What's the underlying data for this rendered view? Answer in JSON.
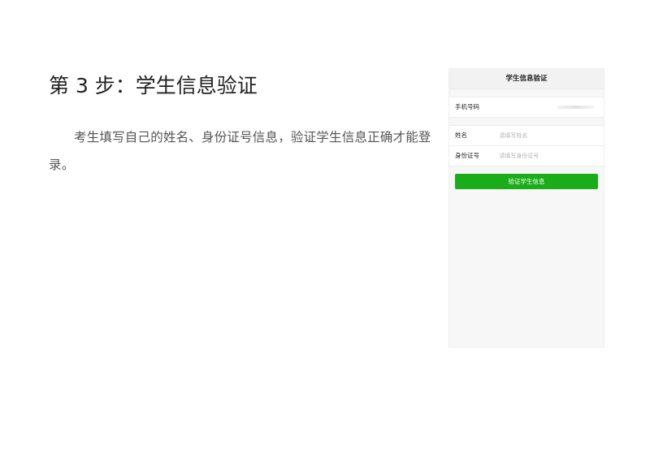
{
  "document": {
    "step_title": "第 3 步：学生信息验证",
    "step_body": "考生填写自己的姓名、身份证号信息，验证学生信息正确才能登录。"
  },
  "phone": {
    "header_title": "学生信息验证",
    "phone_row": {
      "label": "手机号码"
    },
    "name_row": {
      "label": "姓名",
      "placeholder": "请填写姓名"
    },
    "id_row": {
      "label": "身份证号",
      "placeholder": "请填写身份证号"
    },
    "verify_button": "验证学生信息",
    "accent_color": "#1aad19"
  }
}
